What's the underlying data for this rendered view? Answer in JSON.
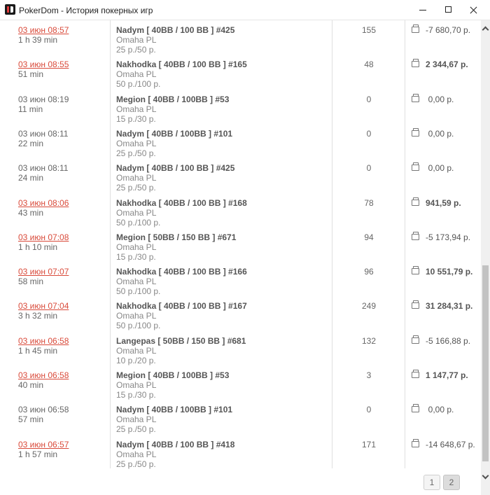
{
  "window": {
    "title": "PokerDom - История покерных игр"
  },
  "rows": [
    {
      "date": "03 июн 08:57",
      "date_link": true,
      "duration": "1 h 39 min",
      "table": "Nadym [ 40BB / 100 BB ] #425",
      "game": "Omaha PL",
      "stakes": "25 р./50 р.",
      "hands": "155",
      "result": "-7 680,70 р.",
      "result_type": "negative"
    },
    {
      "date": "03 июн 08:55",
      "date_link": true,
      "duration": "51 min",
      "table": "Nakhodka [ 40BB / 100 BB ] #165",
      "game": "Omaha PL",
      "stakes": "50 р./100 р.",
      "hands": "48",
      "result": "2 344,67 р.",
      "result_type": "positive"
    },
    {
      "date": "03 июн 08:19",
      "date_link": false,
      "duration": "11 min",
      "table": "Megion [ 40BB / 100BB ] #53",
      "game": "Omaha PL",
      "stakes": "15 р./30 р.",
      "hands": "0",
      "result": "0,00 р.",
      "result_type": "zero"
    },
    {
      "date": "03 июн 08:11",
      "date_link": false,
      "duration": "22 min",
      "table": "Nadym [ 40BB / 100BB ] #101",
      "game": "Omaha PL",
      "stakes": "25 р./50 р.",
      "hands": "0",
      "result": "0,00 р.",
      "result_type": "zero"
    },
    {
      "date": "03 июн 08:11",
      "date_link": false,
      "duration": "24 min",
      "table": "Nadym [ 40BB / 100 BB ] #425",
      "game": "Omaha PL",
      "stakes": "25 р./50 р.",
      "hands": "0",
      "result": "0,00 р.",
      "result_type": "zero"
    },
    {
      "date": "03 июн 08:06",
      "date_link": true,
      "duration": "43 min",
      "table": "Nakhodka [ 40BB / 100 BB ] #168",
      "game": "Omaha PL",
      "stakes": "50 р./100 р.",
      "hands": "78",
      "result": "941,59 р.",
      "result_type": "positive"
    },
    {
      "date": "03 июн 07:08",
      "date_link": true,
      "duration": "1 h 10 min",
      "table": "Megion [ 50BB / 150 BB ] #671",
      "game": "Omaha PL",
      "stakes": "15 р./30 р.",
      "hands": "94",
      "result": "-5 173,94 р.",
      "result_type": "negative"
    },
    {
      "date": "03 июн 07:07",
      "date_link": true,
      "duration": "58 min",
      "table": "Nakhodka [ 40BB / 100 BB ] #166",
      "game": "Omaha PL",
      "stakes": "50 р./100 р.",
      "hands": "96",
      "result": "10 551,79 р.",
      "result_type": "positive"
    },
    {
      "date": "03 июн 07:04",
      "date_link": true,
      "duration": "3 h 32 min",
      "table": "Nakhodka [ 40BB / 100 BB ] #167",
      "game": "Omaha PL",
      "stakes": "50 р./100 р.",
      "hands": "249",
      "result": "31 284,31 р.",
      "result_type": "positive"
    },
    {
      "date": "03 июн 06:58",
      "date_link": true,
      "duration": "1 h 45 min",
      "table": "Langepas [ 50BB / 150 BB ] #681",
      "game": "Omaha PL",
      "stakes": "10 р./20 р.",
      "hands": "132",
      "result": "-5 166,88 р.",
      "result_type": "negative"
    },
    {
      "date": "03 июн 06:58",
      "date_link": true,
      "duration": "40 min",
      "table": "Megion [ 40BB / 100BB ] #53",
      "game": "Omaha PL",
      "stakes": "15 р./30 р.",
      "hands": "3",
      "result": "1 147,77 р.",
      "result_type": "positive"
    },
    {
      "date": "03 июн 06:58",
      "date_link": false,
      "duration": "57 min",
      "table": "Nadym [ 40BB / 100BB ] #101",
      "game": "Omaha PL",
      "stakes": "25 р./50 р.",
      "hands": "0",
      "result": "0,00 р.",
      "result_type": "zero"
    },
    {
      "date": "03 июн 06:57",
      "date_link": true,
      "duration": "1 h 57 min",
      "table": "Nadym [ 40BB / 100 BB ] #418",
      "game": "Omaha PL",
      "stakes": "25 р./50 р.",
      "hands": "171",
      "result": "-14 648,67 р.",
      "result_type": "negative"
    }
  ],
  "pagination": {
    "pages": [
      "1",
      "2"
    ],
    "current": "2"
  },
  "icons": {
    "row_result": "wallet-icon",
    "app": "pokerdom-logo-icon"
  },
  "colors": {
    "link_red": "#d94a3a",
    "scroll_thumb": "#c2c2c2"
  }
}
